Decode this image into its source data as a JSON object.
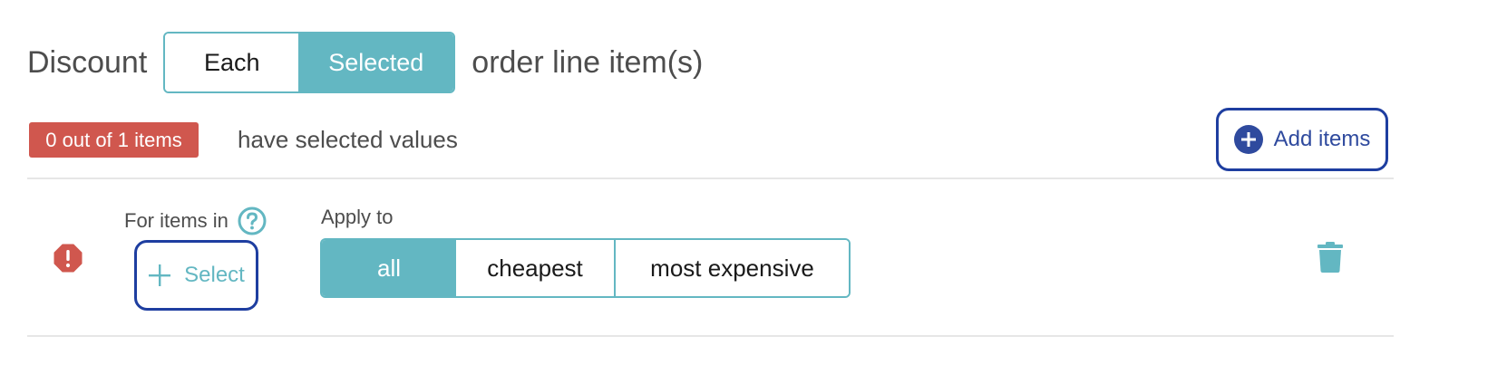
{
  "discount": {
    "label": "Discount",
    "options": [
      {
        "label": "Each",
        "active": false
      },
      {
        "label": "Selected",
        "active": true
      }
    ],
    "suffix": "order line item(s)"
  },
  "status": {
    "badge": "0 out of 1 items",
    "text": "have selected values",
    "badge_color": "#d0574e"
  },
  "add_items": {
    "label": "Add items",
    "icon": "plus-circle-icon"
  },
  "rule": {
    "error_icon": "alert-octagon-icon",
    "for_items_label": "For items in",
    "help_icon": "question-circle-icon",
    "select_label": "Select",
    "apply_label": "Apply to",
    "apply_options": [
      {
        "label": "all",
        "active": true
      },
      {
        "label": "cheapest",
        "active": false
      },
      {
        "label": "most expensive",
        "active": false
      }
    ],
    "delete_icon": "trash-icon"
  },
  "colors": {
    "accent": "#63b7c2",
    "focus": "#1e3ea0",
    "primary_blue": "#2f4a9e",
    "error": "#d0574e"
  }
}
